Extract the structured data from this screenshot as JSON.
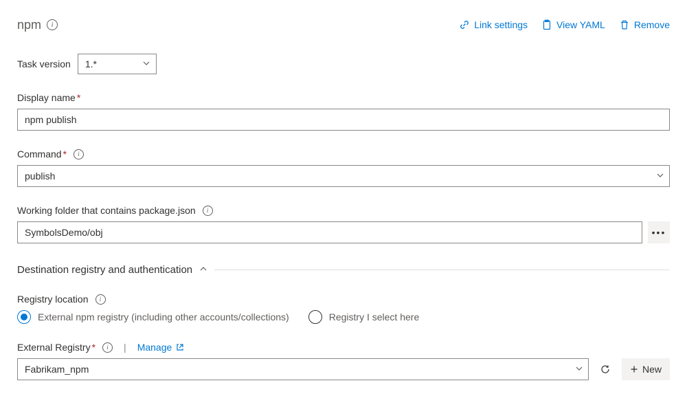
{
  "header": {
    "title": "npm",
    "actions": {
      "link_settings": "Link settings",
      "view_yaml": "View YAML",
      "remove": "Remove"
    }
  },
  "task_version": {
    "label": "Task version",
    "value": "1.*"
  },
  "display_name": {
    "label": "Display name",
    "value": "npm publish"
  },
  "command": {
    "label": "Command",
    "value": "publish"
  },
  "working_folder": {
    "label": "Working folder that contains package.json",
    "value": "SymbolsDemo/obj"
  },
  "section": {
    "title": "Destination registry and authentication"
  },
  "registry_location": {
    "label": "Registry location",
    "options": {
      "external": "External npm registry (including other accounts/collections)",
      "select_here": "Registry I select here"
    },
    "selected": "external"
  },
  "external_registry": {
    "label": "External Registry",
    "manage": "Manage",
    "value": "Fabrikam_npm",
    "new_label": "New"
  }
}
